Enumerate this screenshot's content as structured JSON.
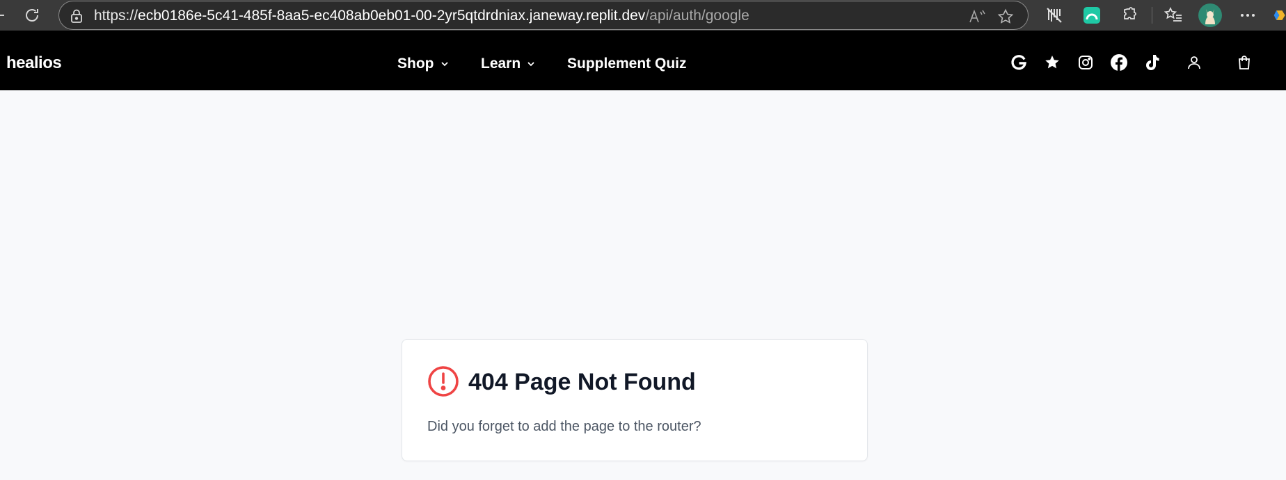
{
  "browser": {
    "url_scheme": "https://",
    "url_host": "ecb0186e-5c41-485f-8aa5-ec408ab0eb01-00-2yr5qtdrdniax.janeway.replit.dev",
    "url_path": "/api/auth/google",
    "icons": [
      "reload-icon",
      "lock-icon",
      "read-aloud-icon",
      "favorite-star-icon",
      "tracking-extension-icon",
      "green-extension-icon",
      "extensions-puzzle-icon",
      "favorites-list-icon",
      "profile-avatar-icon",
      "more-menu-icon",
      "copilot-icon"
    ]
  },
  "site": {
    "logo": "healios",
    "nav": [
      {
        "label": "Shop",
        "has_dropdown": true
      },
      {
        "label": "Learn",
        "has_dropdown": true
      },
      {
        "label": "Supplement Quiz",
        "has_dropdown": false
      }
    ],
    "header_icons": [
      "google-icon",
      "star-icon",
      "instagram-icon",
      "facebook-icon",
      "tiktok-icon",
      "account-icon",
      "cart-icon"
    ]
  },
  "error_card": {
    "title": "404 Page Not Found",
    "message": "Did you forget to add the page to the router?",
    "icon": "alert-circle-icon",
    "icon_color": "#ef4444"
  },
  "colors": {
    "browser_bar": "#3a3a3a",
    "header_bg": "#000000",
    "page_bg": "#f8f9fb",
    "title_text": "#111827",
    "body_text": "#4b5563"
  }
}
